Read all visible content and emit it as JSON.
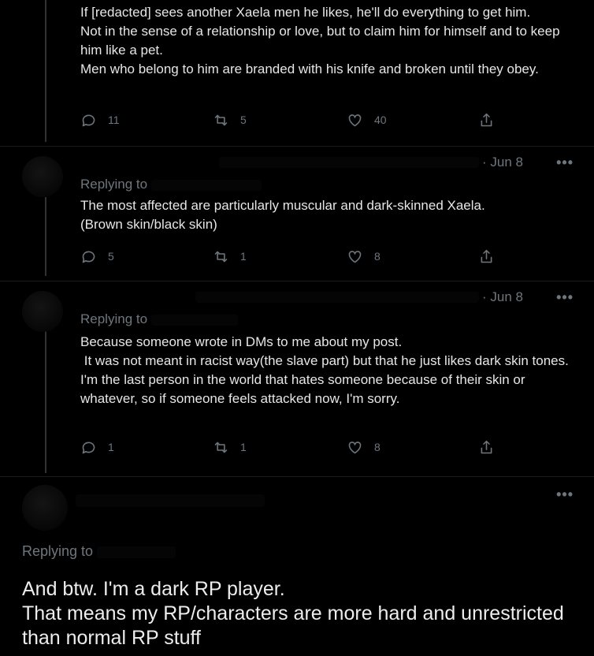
{
  "tweets": [
    {
      "text": "If [redacted] sees another Xaela men he likes, he'll do everything to get him.\nNot in the sense of a relationship or love, but to claim him for himself and to keep him like a pet.\nMen who belong to him are branded with his knife and broken until they obey.",
      "replies": "11",
      "retweets": "5",
      "likes": "40"
    },
    {
      "date": "· Jun 8",
      "replying_label": "Replying to",
      "text": "The most affected are particularly muscular and dark-skinned Xaela.\n(Brown skin/black skin)",
      "replies": "5",
      "retweets": "1",
      "likes": "8"
    },
    {
      "date": "· Jun 8",
      "replying_label": "Replying to",
      "text": "Because someone wrote in DMs to me about my post.\n It was not meant in racist way(the slave part) but that he just likes dark skin tones.\nI'm the last person in the world that hates someone because of their skin or whatever, so if someone feels attacked now, I'm sorry.",
      "replies": "1",
      "retweets": "1",
      "likes": "8"
    }
  ],
  "final_tweet": {
    "replying_label": "Replying to",
    "text": "And btw. I'm a dark RP player.\nThat means my RP/characters are more hard and unrestricted than normal RP stuff"
  },
  "icons": {
    "more": "more-horizontal-icon",
    "reply": "comment-icon",
    "retweet": "retweet-icon",
    "like": "heart-icon",
    "share": "share-icon"
  },
  "colors": {
    "background": "#000000",
    "text": "#e6e6e6",
    "muted": "#6e767d",
    "link": "#1d63a8"
  }
}
